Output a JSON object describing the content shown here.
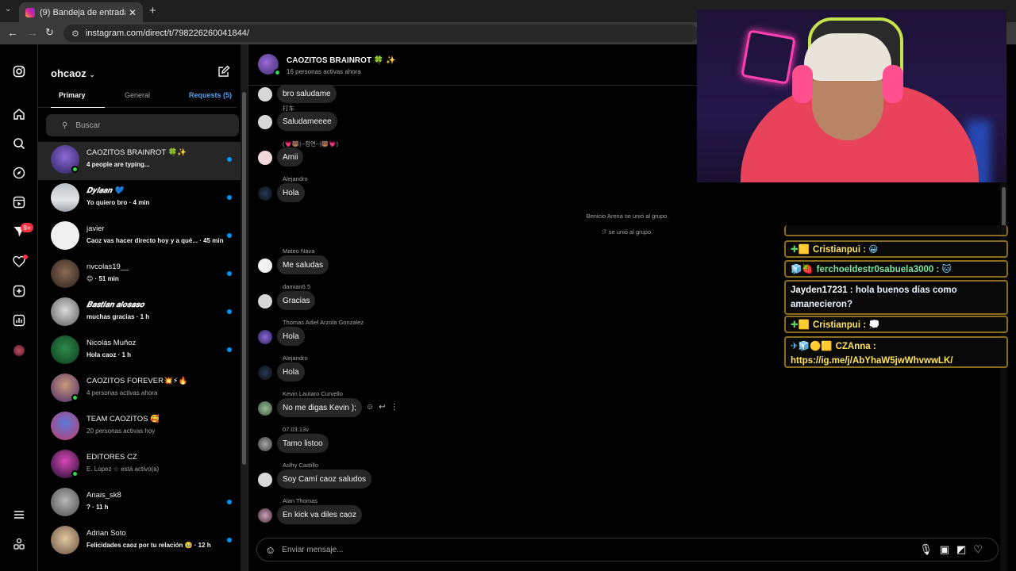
{
  "browser": {
    "tab_title": "(9) Bandeja de entrada • Direct",
    "url": "instagram.com/direct/t/798226260041844/",
    "tab_close": "✕",
    "new_tab": "+"
  },
  "rail": {
    "badge_count": "9+"
  },
  "inbox": {
    "username": "ohcaoz",
    "tabs": {
      "primary": "Primary",
      "general": "General",
      "requests": "Requests (5)"
    },
    "search_placeholder": "Buscar",
    "conversations": [
      {
        "name": "CAOZITOS BRAINROT 🍀✨",
        "preview": "4 people are typing...",
        "bold": true,
        "unread": true,
        "online": true
      },
      {
        "name": "𝑫𝒚𝒍𝒂𝒂𝒏 💙",
        "preview": "Yo quiero bro · 4 min",
        "bold": true,
        "unread": true,
        "online": false
      },
      {
        "name": "javier",
        "preview": "Caoz vas hacer directo hoy y a qué... · 45 min",
        "bold": true,
        "unread": true,
        "online": false
      },
      {
        "name": "nvcolas19__",
        "preview": "😊 · 51 min",
        "bold": true,
        "unread": true,
        "online": false
      },
      {
        "name": "𝑩𝒂𝒔𝒕𝒊𝒂𝒏 𝒂𝒍𝒐𝒔𝒂𝒔𝒐",
        "preview": "muchas gracias · 1 h",
        "bold": true,
        "unread": true,
        "online": false
      },
      {
        "name": "Nicolás Muñoz",
        "preview": "Hola caoz · 1 h",
        "bold": true,
        "unread": true,
        "online": false
      },
      {
        "name": "CAOZITOS FOREVER💥⚡🔥",
        "preview": "4 personas activas ahora",
        "bold": false,
        "unread": false,
        "online": true
      },
      {
        "name": "TEAM CAOZITOS 🥰",
        "preview": "20 personas activas hoy",
        "bold": false,
        "unread": false,
        "online": false
      },
      {
        "name": "EDITORES CZ",
        "preview": "E. Lopez ☆ está activo(a)",
        "bold": false,
        "unread": false,
        "online": true
      },
      {
        "name": "Anais_sk8",
        "preview": "? · 11 h",
        "bold": true,
        "unread": true,
        "online": false
      },
      {
        "name": "Adrian Soto",
        "preview": "Felicidades caoz por tu relación 🥹 · 12 h",
        "bold": true,
        "unread": true,
        "online": false
      }
    ]
  },
  "chat": {
    "group_name": "CAOZITOS BRAINROT 🍀 ✨",
    "group_status": "16 personas activas ahora",
    "messages": [
      {
        "sender": "",
        "text": "bro saludame"
      },
      {
        "sender": "打车",
        "text": "Saludameeee"
      },
      {
        "sender": "(💗🐻|--정연--|🐻💗)",
        "text": "Amii"
      },
      {
        "sender": "Alejandro",
        "text": "Hola"
      },
      {
        "sender": "Mateo Nava",
        "text": "Me saludas"
      },
      {
        "sender": "damian6.5",
        "text": "Gracias"
      },
      {
        "sender": "Thomas Adiel Arzola Gonzalez",
        "text": "Hola"
      },
      {
        "sender": "Alejandro",
        "text": "Hola"
      },
      {
        "sender": "Kevin Lautaro Curvello",
        "text": "No me digas Kevin );"
      },
      {
        "sender": "07.03.13v",
        "text": "Tamo listoo"
      },
      {
        "sender": "Aslhy Castillo",
        "text": "Soy Camí caoz saludos"
      },
      {
        "sender": "Alan Thomas",
        "text": "En kick va diles caoz"
      }
    ],
    "system": [
      "Benicio Arena se unió al grupo.",
      "ℱ se unió al grupo."
    ],
    "composer_placeholder": "Enviar mensaje..."
  },
  "stream_chat": [
    {
      "user": "Cristianpui :",
      "msg": "😀",
      "icons": "✚🟨"
    },
    {
      "user": "ferchoeldestr0sabuela3000 :",
      "msg": "🐱",
      "icons": "🧊🍓"
    },
    {
      "user": "Jayden17231 :",
      "msg": "hola buenos días como amanecieron?",
      "icons": ""
    },
    {
      "user": "Cristianpui :",
      "msg": "💭",
      "icons": "✚🟨"
    },
    {
      "user": "CZAnna :",
      "msg": "https://ig.me/j/AbYhaW5jwWhvwwLK/",
      "icons": "✈🧊🟡🟨"
    }
  ]
}
